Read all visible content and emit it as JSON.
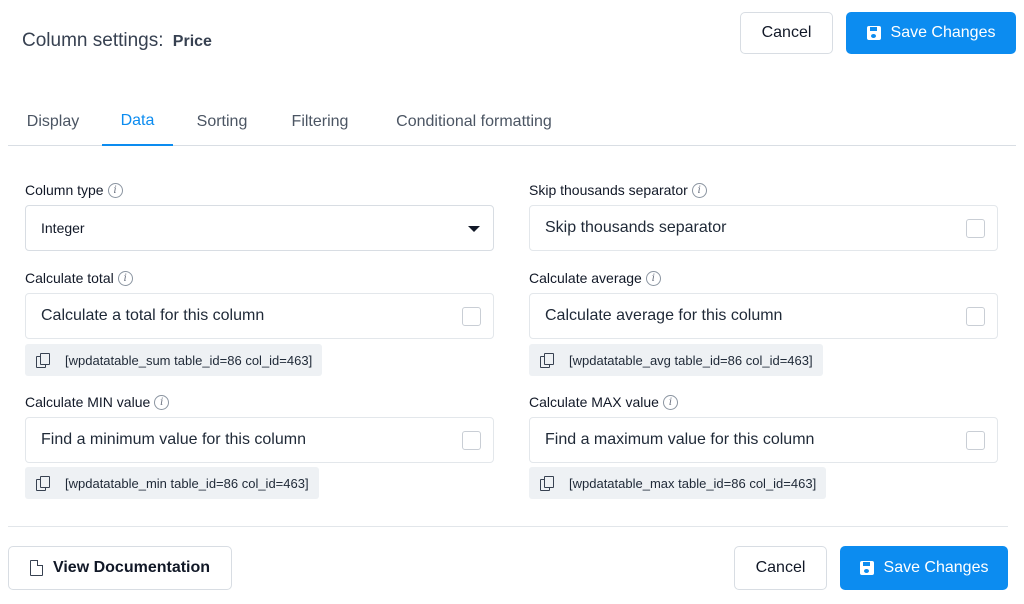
{
  "header": {
    "title_prefix": "Column settings:",
    "column_name": "Price",
    "cancel_label": "Cancel",
    "save_label": "Save Changes"
  },
  "tabs": [
    {
      "label": "Display",
      "active": false
    },
    {
      "label": "Data",
      "active": true
    },
    {
      "label": "Sorting",
      "active": false
    },
    {
      "label": "Filtering",
      "active": false
    },
    {
      "label": "Conditional formatting",
      "active": false
    }
  ],
  "fields": {
    "column_type": {
      "label": "Column type",
      "value": "Integer"
    },
    "skip_thousands": {
      "label": "Skip thousands separator",
      "checkbox_label": "Skip thousands separator",
      "checked": false
    },
    "calc_total": {
      "label": "Calculate total",
      "checkbox_label": "Calculate a total for this column",
      "checked": false,
      "shortcode": "[wpdatatable_sum table_id=86 col_id=463]"
    },
    "calc_average": {
      "label": "Calculate average",
      "checkbox_label": "Calculate average for this column",
      "checked": false,
      "shortcode": "[wpdatatable_avg table_id=86 col_id=463]"
    },
    "calc_min": {
      "label": "Calculate MIN value",
      "checkbox_label": "Find a minimum value for this column",
      "checked": false,
      "shortcode": "[wpdatatable_min table_id=86 col_id=463]"
    },
    "calc_max": {
      "label": "Calculate MAX value",
      "checkbox_label": "Find a maximum value for this column",
      "checked": false,
      "shortcode": "[wpdatatable_max table_id=86 col_id=463]"
    }
  },
  "footer": {
    "doc_label": "View Documentation",
    "cancel_label": "Cancel",
    "save_label": "Save Changes"
  },
  "colors": {
    "accent": "#0c8cf0",
    "border": "#d8dde3",
    "shortcode_bg": "#eef1f4"
  },
  "icons": {
    "info": "info-icon",
    "copy": "copy-icon",
    "save": "save-icon",
    "document": "document-icon",
    "caret": "caret-down-icon"
  }
}
